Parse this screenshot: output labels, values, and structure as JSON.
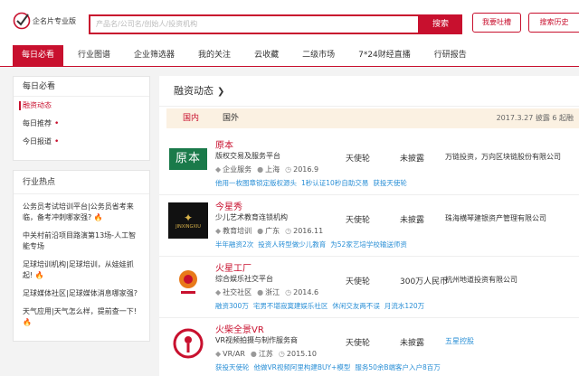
{
  "header": {
    "logo_text": "企名片专业版",
    "search_placeholder": "产品名/公司名/创始人/投资机构",
    "search_button": "搜索",
    "feedback_button": "我要吐槽",
    "history_button": "搜索历史"
  },
  "nav": [
    {
      "label": "每日必看",
      "active": true
    },
    {
      "label": "行业图谱",
      "active": false
    },
    {
      "label": "企业筛选器",
      "active": false
    },
    {
      "label": "我的关注",
      "active": false
    },
    {
      "label": "云收藏",
      "active": false
    },
    {
      "label": "二级市场",
      "active": false
    },
    {
      "label": "7*24财经直播",
      "active": false
    },
    {
      "label": "行研报告",
      "active": false
    }
  ],
  "sidebar": {
    "daily": {
      "title": "每日必看",
      "items": [
        {
          "label": "融资动态",
          "active": true,
          "dot": false
        },
        {
          "label": "每日推荐",
          "active": false,
          "dot": true
        },
        {
          "label": "今日报道",
          "active": false,
          "dot": true
        }
      ]
    },
    "hot": {
      "title": "行业热点",
      "items": [
        "公务员考试培训平台|公务员省考来临，备考冲刺哪家强?",
        "中关村前沿项目路演第13场-人工智能专场",
        "足球培训机构|足球培训，从娃娃抓起!",
        "足球媒体社区|足球媒体消息哪家强?",
        "天气应用|天气怎么样，提前查一下!"
      ]
    }
  },
  "main": {
    "title": "融资动态",
    "tabs": {
      "active": "国内",
      "other": "国外"
    },
    "status": "2017.3.27 披露 6 起融",
    "rows": [
      {
        "name": "原本",
        "desc": "版权交易及服务平台",
        "industry": "企业服务",
        "location": "上海",
        "date": "2016.9",
        "round": "天使轮",
        "amount": "未披露",
        "investors": "万链投资，万向区块链股份有限公司",
        "investor_link": false,
        "tags": [
          "他用一枚图章锁定版权源头",
          "1秒认证10秒自助交易",
          "获投天使轮"
        ],
        "logo_text": "原本"
      },
      {
        "name": "今星秀",
        "desc": "少儿艺术教育连锁机构",
        "industry": "教育培训",
        "location": "广东",
        "date": "2016.11",
        "round": "天使轮",
        "amount": "未披露",
        "investors": "珠海横琴建银资产管理有限公司",
        "investor_link": false,
        "tags": [
          "半年融资2次",
          "投资人转型做少儿教育",
          "为52家艺培学校输送师资"
        ],
        "logo_text": "JINXINGXIU"
      },
      {
        "name": "火星工厂",
        "desc": "综合娱乐社交平台",
        "industry": "社交社区",
        "location": "浙江",
        "date": "2014.6",
        "round": "天使轮",
        "amount": "300万人民币",
        "investors": "杭州地道投资有限公司",
        "investor_link": false,
        "tags": [
          "融资300万",
          "宅男不堪寂寞建娱乐社区",
          "休闲交友两不误",
          "月流水120万"
        ],
        "logo_text": ""
      },
      {
        "name": "火柴全景VR",
        "desc": "VR视频拍摄与制作服务商",
        "industry": "VR/AR",
        "location": "江苏",
        "date": "2015.10",
        "round": "天使轮",
        "amount": "未披露",
        "investors": "五星控股",
        "investor_link": true,
        "tags": [
          "获投天使轮",
          "他做VR视频阿里构建BUY+模型",
          "服务50余B端客户入户8百万"
        ],
        "logo_text": ""
      }
    ]
  },
  "colors": {
    "brand_red": "#c8102e",
    "link_blue": "#2a8fd6",
    "tab_bg": "#fbf1e2"
  }
}
